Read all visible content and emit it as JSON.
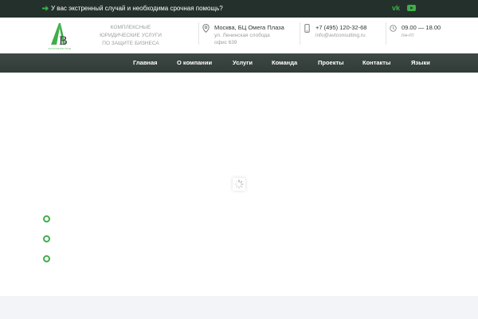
{
  "topbar": {
    "alert_text": "У вас экстренный случай и необходима срочная помощь?",
    "social": {
      "vk_label": "vk",
      "youtube_icon": "youtube-icon"
    },
    "accent": "#3fae49",
    "background": "#24302b"
  },
  "header": {
    "logo_text": "AB",
    "logo_sub": "AVTCONSULTING",
    "tagline_lines": [
      "КОМПЛЕКСНЫЕ",
      "ЮРИДИЧЕСКИЕ УСЛУГИ",
      "ПО ЗАЩИТЕ БИЗНЕСА"
    ],
    "address": {
      "line1": "Москва, БЦ Омега Плаза",
      "line2": "ул. Ленинская слобода",
      "line3": "офис 639",
      "icon": "location-pin-icon"
    },
    "contact": {
      "phone": "+7 (495) 120-32-68",
      "email": "info@avtconsulting.ru",
      "icon": "phone-icon"
    },
    "hours": {
      "time": "09.00 — 18.00",
      "days": "пн-пт",
      "icon": "clock-icon"
    }
  },
  "nav": {
    "items": [
      "Главная",
      "О компании",
      "Услуги",
      "Команда",
      "Проекты",
      "Контакты",
      "Языки"
    ]
  },
  "slider": {
    "dots": 3,
    "active_color": "#3fae49"
  }
}
